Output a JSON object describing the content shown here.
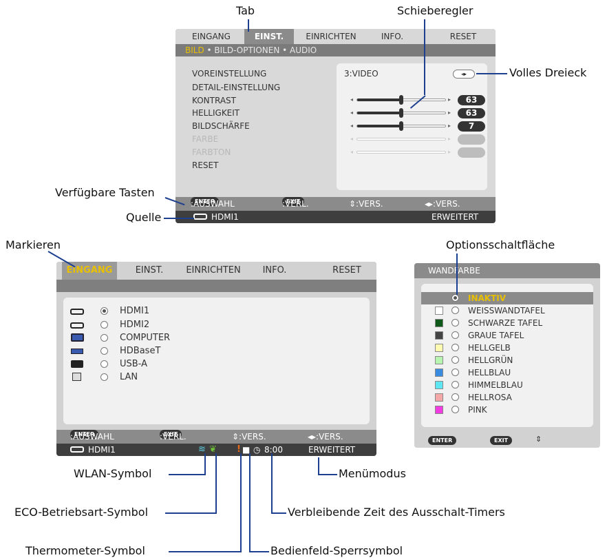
{
  "callouts": {
    "tab": "Tab",
    "slider": "Schieberegler",
    "triangle": "Volles Dreieck",
    "keys": "Verfügbare Tasten",
    "source": "Quelle",
    "highlight": "Markieren",
    "radio": "Optionsschaltfläche",
    "wlan": "WLAN-Symbol",
    "menumode": "Menümodus",
    "eco": "ECO-Betriebsart-Symbol",
    "timer": "Verbleibende Zeit des Ausschalt-Timers",
    "thermo": "Thermometer-Symbol",
    "lock": "Bedienfeld-Sperrsymbol"
  },
  "menu1": {
    "tabs": [
      "EINGANG",
      "EINST.",
      "EINRICHTEN",
      "INFO.",
      "RESET"
    ],
    "subtabs": {
      "active": "BILD",
      "rest": " • BILD-OPTIONEN • AUDIO"
    },
    "items": [
      "VOREINSTELLUNG",
      "DETAIL-EINSTELLUNG",
      "KONTRAST",
      "HELLIGKEIT",
      "BILDSCHÄRFE",
      "FARBE",
      "FARBTON",
      "RESET"
    ],
    "preset_value": "3:VIDEO",
    "values": [
      "63",
      "63",
      "7"
    ],
    "keys": {
      "enter": "ENTER",
      "enter_label": ":AUSWAHL",
      "exit": "EXIT",
      "exit_label": ":VERL.",
      "updown": "⇕:VERS.",
      "leftright": "◂▸:VERS."
    },
    "status": {
      "source": "HDMI1",
      "mode": "ERWEITERT"
    }
  },
  "menu2": {
    "tabs": [
      "EINGANG",
      "EINST.",
      "EINRICHTEN",
      "INFO.",
      "RESET"
    ],
    "inputs": [
      "HDMI1",
      "HDMI2",
      "COMPUTER",
      "HDBaseT",
      "USB-A",
      "LAN"
    ],
    "keys": {
      "enter": "ENTER",
      "enter_label": ":AUSWAHL",
      "exit": "EXIT",
      "exit_label": ":VERL.",
      "updown": "⇕:VERS.",
      "leftright": "◂▸:VERS."
    },
    "status": {
      "source": "HDMI1",
      "timer": "8:00",
      "mode": "ERWEITERT"
    }
  },
  "menu3": {
    "title": "WANDFARBE",
    "options": [
      "INAKTIV",
      "WEISSWANDTAFEL",
      "SCHWARZE TAFEL",
      "GRAUE TAFEL",
      "HELLGELB",
      "HELLGRÜN",
      "HELLBLAU",
      "HIMMELBLAU",
      "HELLROSA",
      "PINK"
    ],
    "swatches": [
      "",
      "#ffffff",
      "#0f5a1a",
      "#444444",
      "#fffbb0",
      "#b8f5b0",
      "#3a8ce0",
      "#5ee6f2",
      "#f5a8a8",
      "#f03ce0"
    ],
    "keys": {
      "enter": "ENTER",
      "exit": "EXIT",
      "updown": "⇕"
    }
  },
  "colors": {
    "highlight": "#e8c000",
    "callout_line": "#1d3f8f"
  }
}
